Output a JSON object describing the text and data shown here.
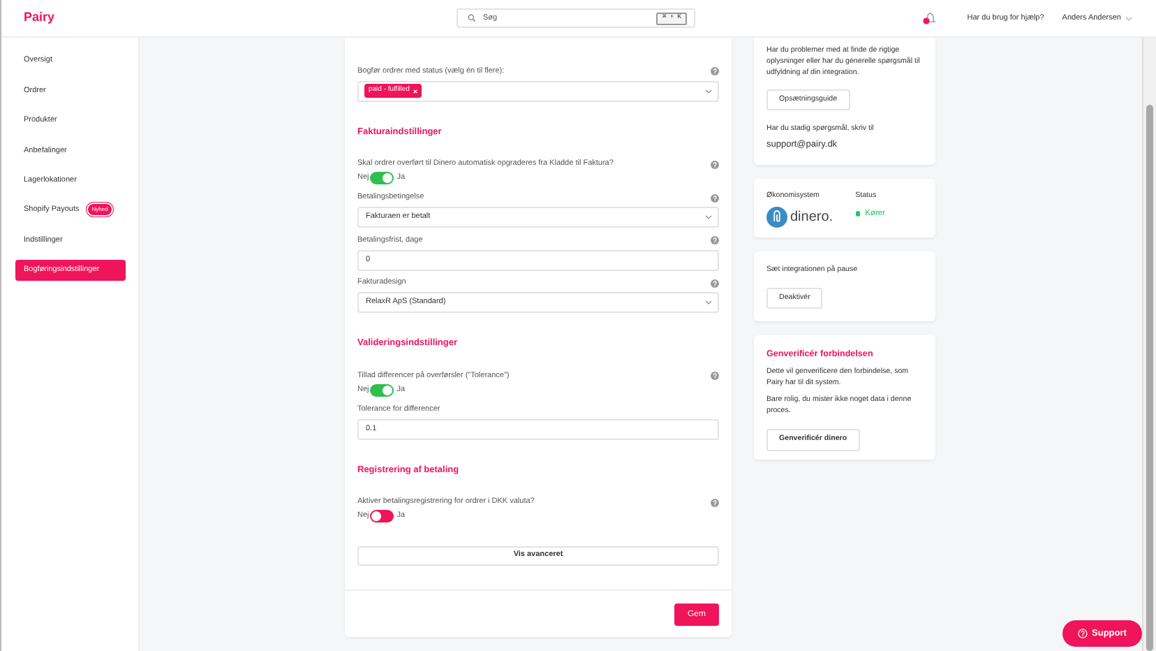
{
  "header": {
    "logo": "Pairy",
    "search": {
      "placeholder": "Søg",
      "shortcut": "⌘ + K"
    },
    "notifications": {
      "unread": true
    },
    "help_link": "Har du brug for hjælp?",
    "user": "Anders Andersen"
  },
  "sidebar": {
    "items": [
      {
        "label": "Oversigt",
        "selected": false
      },
      {
        "label": "Ordrer",
        "selected": false
      },
      {
        "label": "Produkter",
        "selected": false
      },
      {
        "label": "Anbefalinger",
        "selected": false
      },
      {
        "label": "Lagerlokationer",
        "selected": false
      },
      {
        "label": "Shopify Payouts",
        "selected": false,
        "badge": "Nyhed"
      },
      {
        "label": "Indstillinger",
        "selected": false
      },
      {
        "label": "Bogføringsindstillinger",
        "selected": true
      }
    ]
  },
  "form": {
    "items": [
      {
        "kind": "tags",
        "label": "Bogfør ordrer med status (vælg én til flere):",
        "help": true,
        "tags": [
          "paid - fulfilled"
        ]
      },
      {
        "kind": "section",
        "label": "Fakturaindstillinger"
      },
      {
        "kind": "toggle",
        "label": "Skal ordrer overført til Dinero automatisk opgraderes fra Kladde til Faktura?",
        "help": true,
        "off_label": "Nej",
        "on_label": "Ja",
        "on": true
      },
      {
        "kind": "select",
        "label": "Betalingsbetingelse",
        "help": true,
        "value": "Fakturaen er betalt"
      },
      {
        "kind": "input",
        "label": "Betalingsfrist, dage",
        "help": true,
        "value": "0"
      },
      {
        "kind": "select",
        "label": "Fakturadesign",
        "help": true,
        "value": "RelaxR ApS (Standard)"
      },
      {
        "kind": "section",
        "label": "Valideringsindstillinger"
      },
      {
        "kind": "toggle",
        "label": "Tillad differencer på overførsler (\"Tolerance\")",
        "help": true,
        "off_label": "Nej",
        "on_label": "Ja",
        "on": true
      },
      {
        "kind": "input",
        "label": "Tolerance for differencer",
        "help": false,
        "value": "0.1"
      },
      {
        "kind": "section",
        "label": "Registrering af betaling"
      },
      {
        "kind": "toggle",
        "label": "Aktiver betalingsregistrering for ordrer i DKK valuta?",
        "help": true,
        "off_label": "Nej",
        "on_label": "Ja",
        "on": false
      },
      {
        "kind": "button",
        "label": "Vis avanceret"
      }
    ],
    "save_button": "Gem"
  },
  "help_card": {
    "text": "Har du problemer med at finde de rigtige oplysninger eller har du generelle spørgsmål til udfyldning af din integration.",
    "button": "Opsætningsguide",
    "contact_text": "Har du stadig spørgsmål, skriv til",
    "email": "support@pairy.dk"
  },
  "system_card": {
    "system_label": "Økonomisystem",
    "logo_text": "dinero.",
    "status_label": "Status",
    "status": "Kører"
  },
  "pause_card": {
    "text": "Sæt integrationen på pause",
    "button": "Deaktivér"
  },
  "reverify_card": {
    "title": "Genverificér forbindelsen",
    "paragraphs": [
      "Dette vil genverificere den forbindelse, som Pairy har til dit system.",
      "Bare rolig, du mister ikke noget data i denne proces."
    ],
    "button": "Genverificér dinero"
  },
  "support_button": "Support"
}
